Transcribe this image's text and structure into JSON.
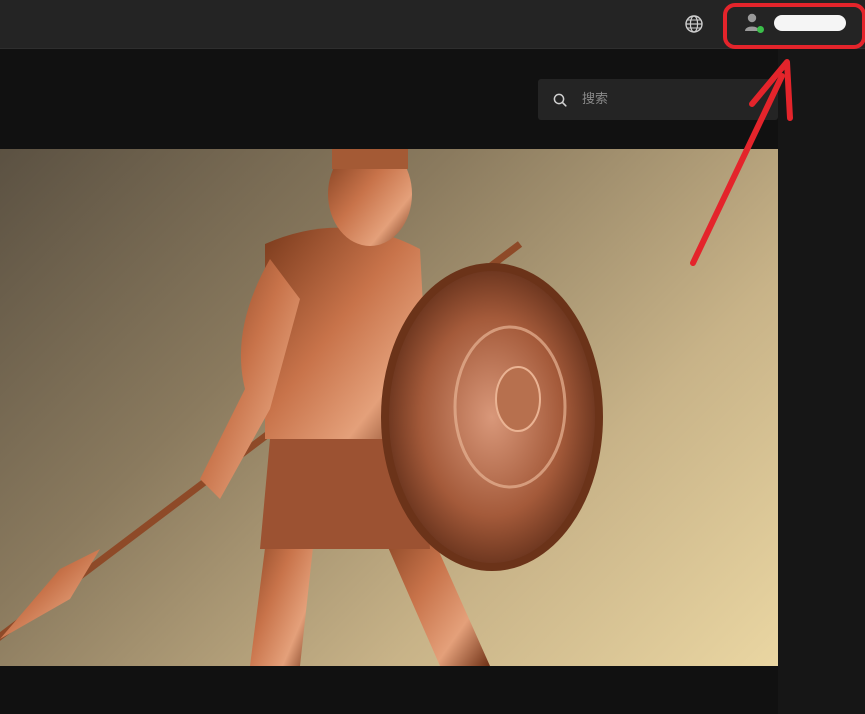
{
  "header": {
    "language_icon": "globe-icon",
    "user": {
      "avatar_icon": "user-avatar-icon",
      "status_color": "#3bbf4a",
      "name_redacted": true
    }
  },
  "search": {
    "placeholder": "搜索",
    "value": ""
  },
  "hero": {
    "image_label": "bronze-spartan-warrior-statue"
  },
  "annotation": {
    "color": "#e4242b"
  }
}
